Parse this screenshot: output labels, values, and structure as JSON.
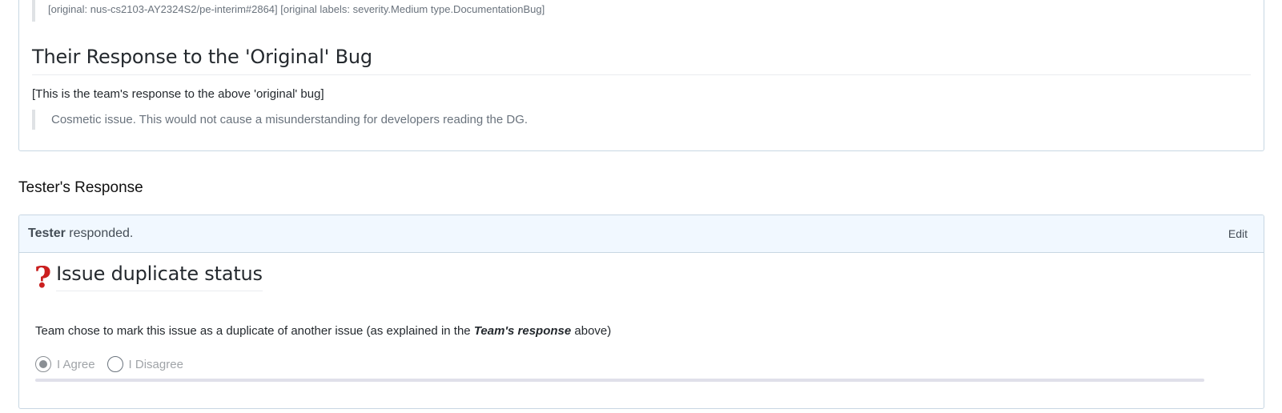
{
  "original_card": {
    "meta_line": "[original: nus-cs2103-AY2324S2/pe-interim#2864] [original labels: severity.Medium type.DocumentationBug]",
    "heading": "Their Response to the 'Original' Bug",
    "note": "[This is the team's response to the above 'original' bug]",
    "quote": "Cosmetic issue. This would not cause a misunderstanding for developers reading the DG."
  },
  "tester_section": {
    "title": "Tester's Response",
    "header": {
      "actor": "Tester",
      "action": " responded.",
      "edit_label": "Edit"
    },
    "issue": {
      "icon": "red-question-mark-icon",
      "title": "Issue duplicate status",
      "desc_prefix": "Team chose to mark this issue as a duplicate of another issue (as explained in the ",
      "desc_emphasis": "Team's response",
      "desc_suffix": " above)"
    },
    "options": [
      {
        "label": "I Agree",
        "selected": true
      },
      {
        "label": "I Disagree",
        "selected": false
      }
    ]
  },
  "colors": {
    "header_bg": "#f1f8ff",
    "border": "#c8d7e3",
    "question_mark": "#cc1f1f"
  }
}
